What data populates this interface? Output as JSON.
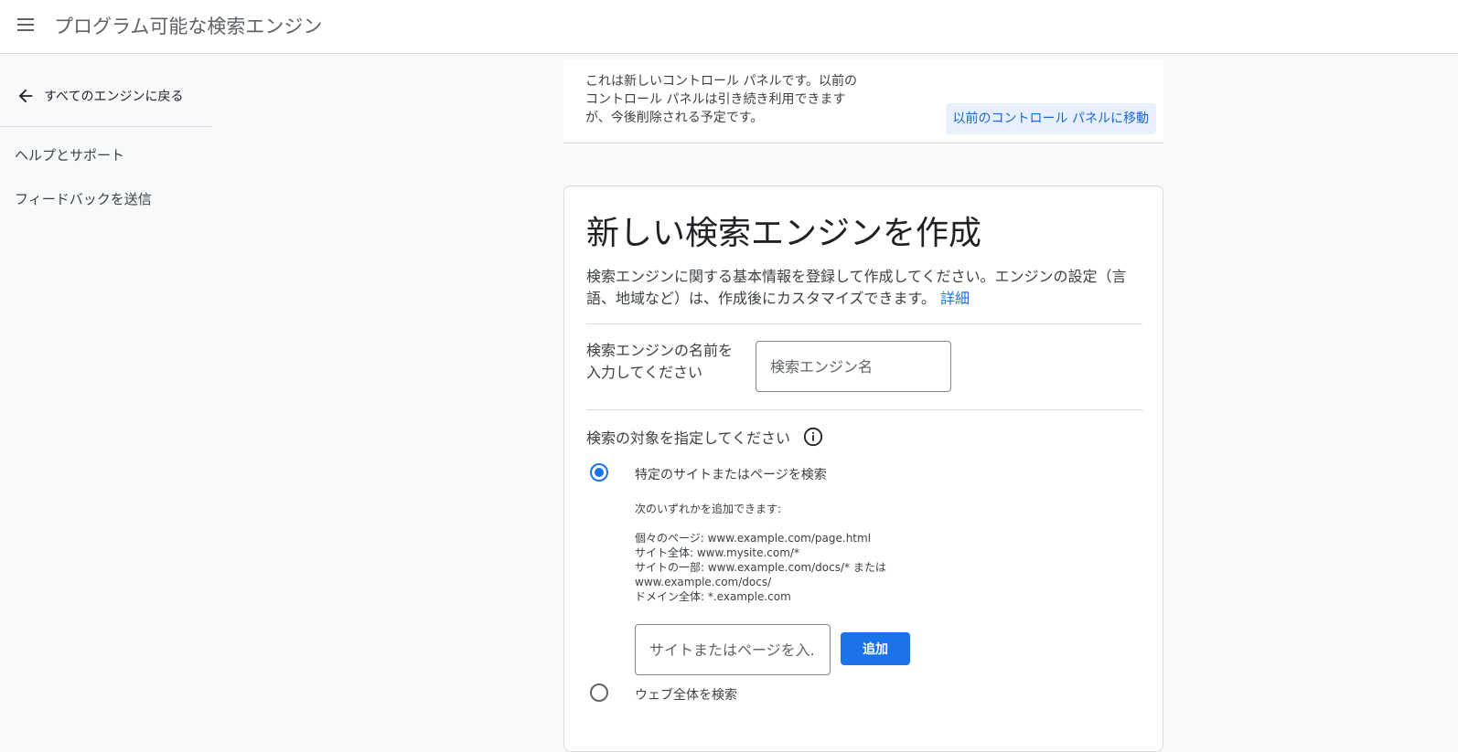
{
  "header": {
    "app_title": "プログラム可能な検索エンジン",
    "menu_icon": "hamburger-menu-icon"
  },
  "sidebar": {
    "back_label": "すべてのエンジンに戻る",
    "back_icon": "arrow-back-icon",
    "items": [
      {
        "label": "ヘルプとサポート"
      },
      {
        "label": "フィードバックを送信"
      }
    ]
  },
  "notice": {
    "text": "これは新しいコントロール パネルです。以前のコントロール パネルは引き続き利用できますが、今後削除される予定です。",
    "button_label": "以前のコントロール パネルに移動"
  },
  "create": {
    "title": "新しい検索エンジンを作成",
    "description": "検索エンジンに関する基本情報を登録して作成してください。エンジンの設定（言語、地域など）は、作成後にカスタマイズできます。",
    "details_link": "詳細",
    "name_label": "検索エンジンの名前を入力してください",
    "name_placeholder": "検索エンジン名",
    "name_value": "",
    "target_label": "検索の対象を指定してください",
    "info_icon": "info-icon",
    "options": [
      {
        "label": "特定のサイトまたはページを検索",
        "selected": true
      },
      {
        "label": "ウェブ全体を検索",
        "selected": false
      }
    ],
    "hint_intro": "次のいずれかを追加できます:",
    "hint_lines": [
      "個々のページ: www.example.com/page.html",
      "サイト全体: www.mysite.com/*",
      "サイトの一部: www.example.com/docs/* または",
      "www.example.com/docs/",
      "ドメイン全体: *.example.com"
    ],
    "site_placeholder": "サイトまたはページを入...",
    "add_label": "追加"
  },
  "colors": {
    "accent": "#1a73e8",
    "notice_button_bg": "#e8f0fe",
    "background": "#f8f9fa"
  }
}
